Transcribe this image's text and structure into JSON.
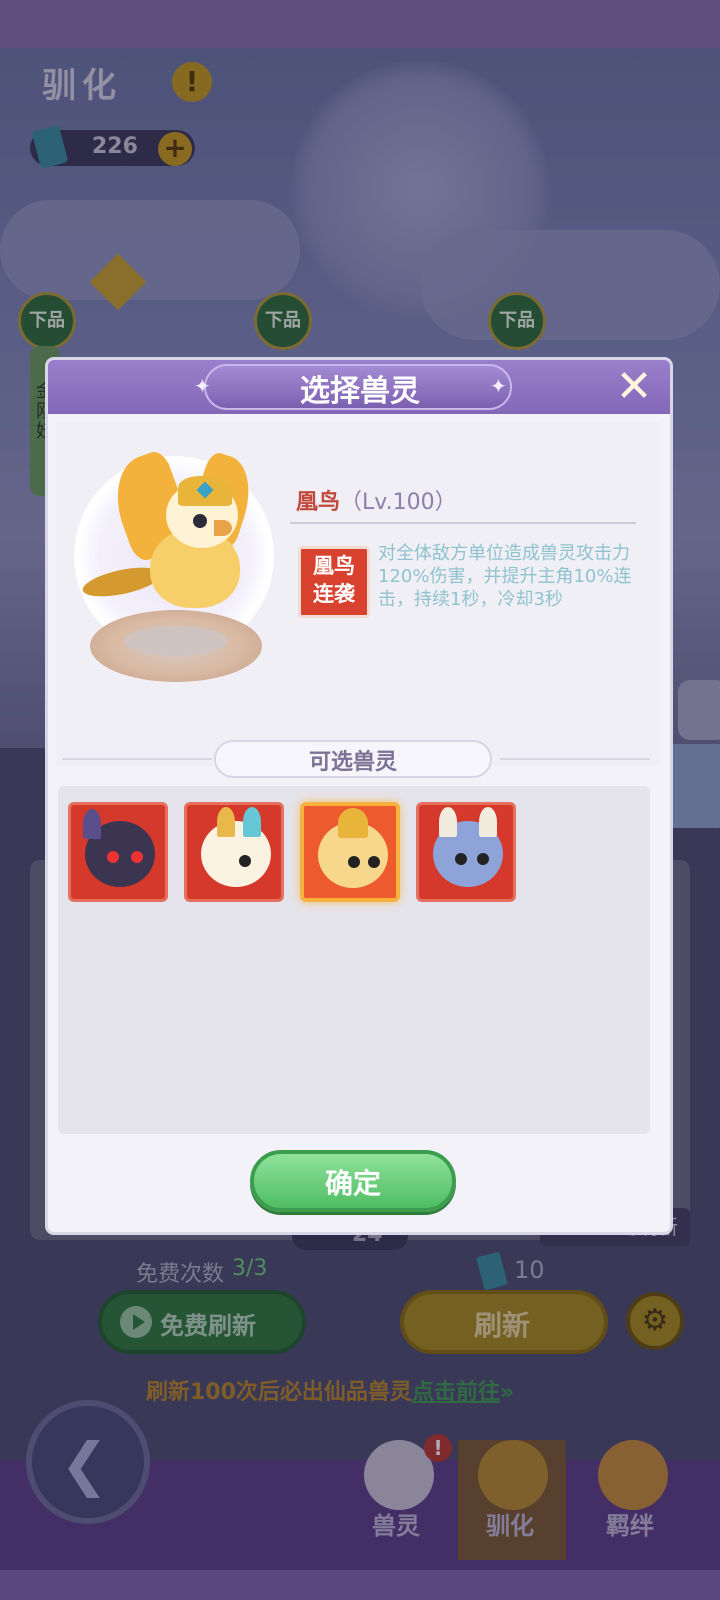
{
  "header": {
    "title": "驯化",
    "currency_value": "226"
  },
  "grades": [
    "下品",
    "下品",
    "下品"
  ],
  "side_card_text": "金刚妖",
  "refresh_cost": "24",
  "auto_refresh_label": "动刷新",
  "free_refresh": {
    "label": "免费次数",
    "count": "3/3",
    "button_label": "免费刷新"
  },
  "paid_refresh": {
    "ticket_count": "10",
    "button_label": "刷新"
  },
  "hint": {
    "text": "刷新100次后必出仙品兽灵",
    "link": "点击前往"
  },
  "bottom_nav": {
    "tabs": [
      "兽灵",
      "驯化",
      "羁绊"
    ],
    "active": "驯化"
  },
  "modal": {
    "title": "选择兽灵",
    "pet": {
      "name": "凰鸟",
      "level": "（Lv.100）",
      "skill_badge": [
        "凰鸟",
        "连袭"
      ],
      "skill_desc": "对全体敌方单位造成兽灵攻击力120%伤害，并提升主角10%连击，持续1秒，冷却3秒"
    },
    "section_label": "可选兽灵",
    "options": [
      "pet-option-bull",
      "pet-option-qilin",
      "pet-option-phoenix",
      "pet-option-ox"
    ],
    "selected_index": 2,
    "confirm_label": "确定"
  }
}
